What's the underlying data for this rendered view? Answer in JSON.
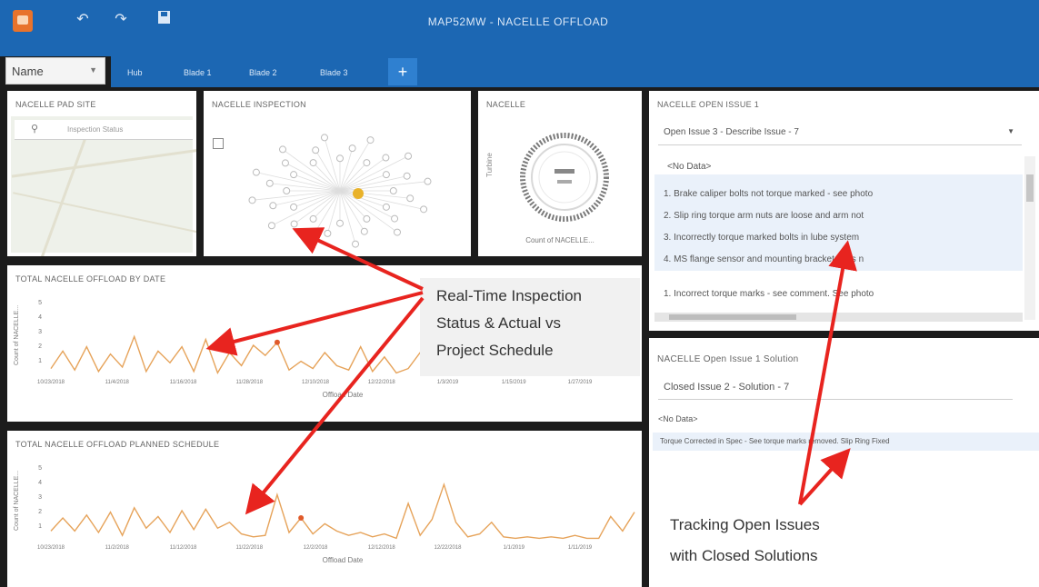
{
  "window": {
    "title": "MAP52MW - NACELLE OFFLOAD"
  },
  "toolbar": {
    "undo_icon": "undo-icon",
    "redo_icon": "redo-icon",
    "save_icon": "save-icon"
  },
  "sheet_selector": {
    "value": "Name"
  },
  "tabs": [
    {
      "label": "Hub"
    },
    {
      "label": "Blade 1"
    },
    {
      "label": "Blade 2"
    },
    {
      "label": "Blade 3"
    }
  ],
  "add_tab_label": "+",
  "panels": {
    "pad_site": {
      "title": "NACELLE PAD SITE",
      "search_placeholder": "Inspection Status"
    },
    "inspection": {
      "title": "NACELLE INSPECTION"
    },
    "nacelle": {
      "title": "NACELLE",
      "axis_label": "Turbine",
      "caption": "Count of NACELLE..."
    },
    "open_issue": {
      "title": "NACELLE OPEN ISSUE 1",
      "filter": "Open Issue 3 - Describe Issue - 7",
      "no_data": "<No Data>",
      "items": [
        "1. Brake caliper bolts not torque marked - see photo",
        "2. Slip ring torque arm nuts are loose and arm not",
        "3. Incorrectly torque marked bolts in lube system",
        "4. MS flange sensor and mounting bracket bolts n"
      ],
      "extra_item": "1. Incorrect torque marks - see comment. See photo"
    },
    "open_issue_solution": {
      "title": "NACELLE Open Issue 1 Solution",
      "filter": "Closed Issue 2 - Solution - 7",
      "no_data": "<No Data>",
      "item": "Torque Corrected in Spec - See torque marks removed. Slip Ring Fixed"
    }
  },
  "charts": {
    "actual": {
      "title": "TOTAL NACELLE OFFLOAD BY DATE",
      "ylabel": "Count of NACELLE...",
      "xlabel": "Offload Date"
    },
    "planned": {
      "title": "TOTAL NACELLE OFFLOAD PLANNED SCHEDULE",
      "ylabel": "Count of NACELLE...",
      "xlabel": "Offload Date"
    }
  },
  "chart_data": [
    {
      "type": "line",
      "title": "TOTAL NACELLE OFFLOAD BY DATE",
      "xlabel": "Offload Date",
      "ylabel": "Count of NACELLE...",
      "ylim": [
        0,
        5
      ],
      "yticks": [
        1,
        2,
        3,
        4,
        5
      ],
      "x_tick_labels": [
        "10/23/2018",
        "11/4/2018",
        "11/16/2018",
        "11/28/2018",
        "12/10/2018",
        "12/22/2018",
        "1/3/2019",
        "1/15/2019",
        "1/27/2019"
      ],
      "series": [
        {
          "values": [
            0.4,
            1.6,
            0.3,
            1.9,
            0.2,
            1.4,
            0.5,
            2.6,
            0.2,
            1.6,
            0.8,
            1.9,
            0.2,
            2.4,
            0.1,
            1.5,
            0.6,
            2.0,
            1.3,
            2.2,
            0.3,
            0.9,
            0.4,
            1.5,
            0.6,
            0.3,
            1.9,
            0.2,
            1.2,
            0.1,
            0.4,
            1.5,
            0.5,
            0.1,
            3.6,
            1.3,
            0.4,
            0.1,
            0.3,
            4.8,
            0.8,
            0.1,
            0.9,
            0.1,
            2.0,
            0.2,
            0.1,
            0.0,
            0.0,
            0.0
          ],
          "color": "#e6a35a"
        }
      ],
      "highlight_index": 19,
      "grid": false
    },
    {
      "type": "line",
      "title": "TOTAL NACELLE OFFLOAD PLANNED SCHEDULE",
      "xlabel": "Offload Date",
      "ylabel": "Count of NACELLE...",
      "ylim": [
        0,
        5
      ],
      "yticks": [
        1,
        2,
        3,
        4,
        5
      ],
      "x_tick_labels": [
        "10/23/2018",
        "11/2/2018",
        "11/12/2018",
        "11/22/2018",
        "12/2/2018",
        "12/12/2018",
        "12/22/2018",
        "1/1/2019",
        "1/11/2019"
      ],
      "series": [
        {
          "values": [
            0.6,
            1.5,
            0.6,
            1.7,
            0.5,
            1.9,
            0.3,
            2.2,
            0.8,
            1.6,
            0.5,
            2.0,
            0.7,
            2.1,
            0.8,
            1.2,
            0.4,
            0.2,
            0.3,
            3.1,
            0.5,
            1.5,
            0.4,
            1.1,
            0.6,
            0.3,
            0.5,
            0.2,
            0.4,
            0.1,
            2.5,
            0.3,
            1.4,
            3.8,
            1.2,
            0.2,
            0.4,
            1.2,
            0.2,
            0.1,
            0.2,
            0.1,
            0.2,
            0.1,
            0.3,
            0.1,
            0.1,
            1.6,
            0.6,
            1.9
          ],
          "color": "#e6a35a"
        }
      ],
      "highlight_index": 21,
      "grid": false
    }
  ],
  "callouts": {
    "realtime": [
      "Real-Time Inspection",
      "Status & Actual vs",
      "Project Schedule"
    ],
    "tracking": [
      "Tracking Open Issues",
      "with Closed Solutions"
    ]
  },
  "colors": {
    "accent_blue": "#1c67b3",
    "line": "#e6a35a",
    "arrow": "#e8241f",
    "marker": "#e9b22a"
  }
}
